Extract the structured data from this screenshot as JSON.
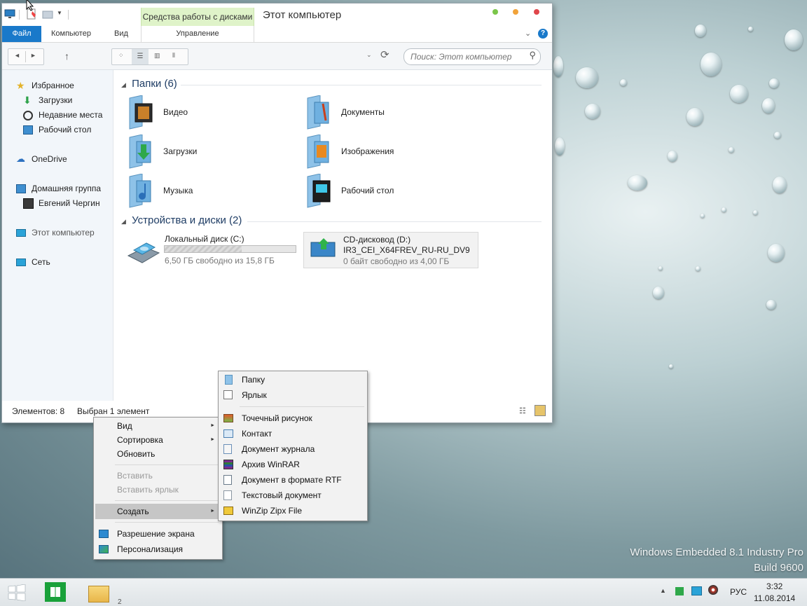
{
  "window": {
    "title": "Этот компьютер",
    "tools_tab": "Средства работы с дисками",
    "ribbon_tabs": [
      "Файл",
      "Компьютер",
      "Вид",
      "Управление"
    ],
    "search_placeholder": "Поиск: Этот компьютер"
  },
  "sidebar": {
    "items": [
      {
        "label": "Избранное",
        "icon": "star-icon"
      },
      {
        "label": "Загрузки",
        "icon": "download-icon"
      },
      {
        "label": "Недавние места",
        "icon": "recent-places-icon"
      },
      {
        "label": "Рабочий стол",
        "icon": "desktop-icon"
      },
      {
        "label": "OneDrive",
        "icon": "onedrive-icon"
      },
      {
        "label": "Домашняя группа",
        "icon": "homegroup-icon"
      },
      {
        "label": "Евгений Чергин",
        "icon": "user-avatar-icon"
      },
      {
        "label": "Этот компьютер",
        "icon": "computer-icon"
      },
      {
        "label": "Сеть",
        "icon": "network-icon"
      }
    ]
  },
  "content": {
    "folders_header": "Папки (6)",
    "folders": [
      {
        "label": "Видео",
        "icon": "video-folder-icon"
      },
      {
        "label": "Документы",
        "icon": "documents-folder-icon"
      },
      {
        "label": "Загрузки",
        "icon": "downloads-folder-icon"
      },
      {
        "label": "Изображения",
        "icon": "pictures-folder-icon"
      },
      {
        "label": "Музыка",
        "icon": "music-folder-icon"
      },
      {
        "label": "Рабочий стол",
        "icon": "desktop-folder-icon"
      }
    ],
    "devices_header": "Устройства и диски (2)",
    "drives": [
      {
        "name": "Локальный диск (C:)",
        "subtitle": "",
        "free": "6,50 ГБ свободно из 15,8 ГБ",
        "used_fraction": 0.59
      },
      {
        "name": "CD-дисковод (D:)",
        "subtitle": "IR3_CEI_X64FREV_RU-RU_DV9",
        "free": "0 байт свободно из 4,00 ГБ"
      }
    ]
  },
  "status": {
    "count": "Элементов: 8",
    "selected": "Выбран 1 элемент"
  },
  "context_menu": {
    "items": [
      {
        "label": "Вид",
        "submenu": true,
        "disabled": false
      },
      {
        "label": "Сортировка",
        "submenu": true,
        "disabled": false
      },
      {
        "label": "Обновить",
        "submenu": false,
        "disabled": false
      },
      {
        "label": "Вставить",
        "submenu": false,
        "disabled": true
      },
      {
        "label": "Вставить ярлык",
        "submenu": false,
        "disabled": true
      },
      {
        "label": "Создать",
        "submenu": true,
        "disabled": false,
        "selected": true
      },
      {
        "label": "Разрешение экрана",
        "submenu": false,
        "disabled": false
      },
      {
        "label": "Персонализация",
        "submenu": false,
        "disabled": false
      }
    ]
  },
  "create_submenu": {
    "items": [
      {
        "label": "Папку",
        "icon": "folder-icon"
      },
      {
        "label": "Ярлык",
        "icon": "shortcut-icon"
      },
      {
        "label": "Точечный рисунок",
        "icon": "bitmap-icon"
      },
      {
        "label": "Контакт",
        "icon": "contact-icon"
      },
      {
        "label": "Документ журнала",
        "icon": "journal-icon"
      },
      {
        "label": "Архив WinRAR",
        "icon": "winrar-icon"
      },
      {
        "label": "Документ в формате RTF",
        "icon": "rtf-icon"
      },
      {
        "label": "Текстовый документ",
        "icon": "text-document-icon"
      },
      {
        "label": "WinZip Zipx File",
        "icon": "winzip-icon"
      }
    ]
  },
  "desktop": {
    "watermark_line1": "Windows Embedded 8.1 Industry Pro",
    "watermark_line2": "Build 9600"
  },
  "taskbar": {
    "explorer_badge": "2",
    "language": "РУС",
    "time": "3:32",
    "date": "11.08.2014"
  },
  "colors": {
    "accent": "#1979ca",
    "tools_tab": "#dff3c9",
    "menu_highlight": "#c6c6c6"
  }
}
